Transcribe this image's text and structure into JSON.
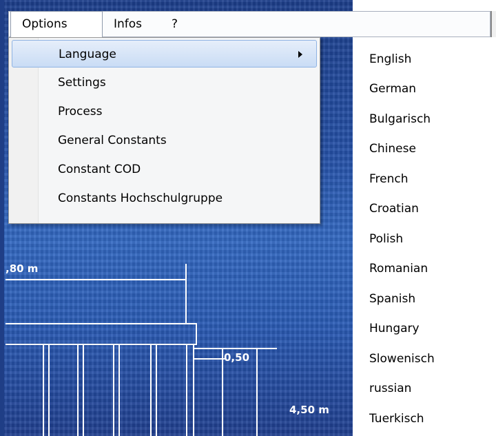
{
  "menubar": {
    "items": [
      "Options",
      "Infos",
      "?"
    ]
  },
  "options_menu": {
    "items": [
      {
        "label": "Language",
        "has_submenu": true
      },
      {
        "label": "Settings"
      },
      {
        "label": "Process"
      },
      {
        "label": "General Constants"
      },
      {
        "label": "Constant COD"
      },
      {
        "label": "Constants Hochschulgruppe"
      }
    ]
  },
  "language_menu": {
    "items": [
      "English",
      "German",
      "Bulgarisch",
      "Chinese",
      "French",
      "Croatian",
      "Polish",
      "Romanian",
      "Spanish",
      "Hungary",
      "Slowenisch",
      "russian",
      "Tuerkisch"
    ]
  },
  "background_figure": {
    "label_depth": ",80 m",
    "label_thickness": "0,50",
    "label_width": "4,50 m"
  },
  "colors": {
    "highlight": "#c9dcf5",
    "water": "#2a5bb5"
  }
}
